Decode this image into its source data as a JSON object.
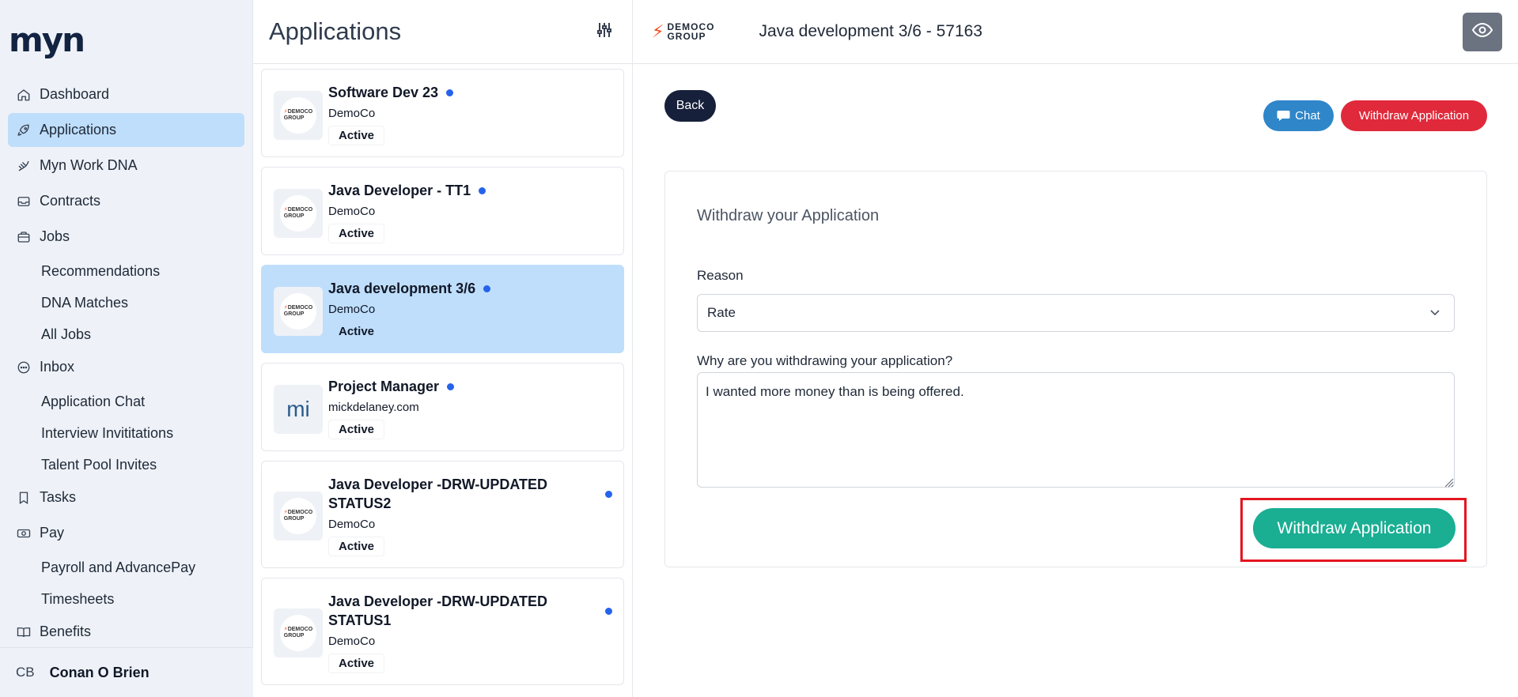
{
  "sidebar": {
    "logo": "myn",
    "items": [
      {
        "label": "Dashboard",
        "icon": "home-icon"
      },
      {
        "label": "Applications",
        "icon": "rocket-icon",
        "active": true
      },
      {
        "label": "Myn Work DNA",
        "icon": "dna-icon"
      },
      {
        "label": "Contracts",
        "icon": "inbox-tray-icon"
      },
      {
        "label": "Jobs",
        "icon": "briefcase-icon",
        "children": [
          "Recommendations",
          "DNA Matches",
          "All Jobs"
        ]
      },
      {
        "label": "Inbox",
        "icon": "chat-bubble-icon",
        "children": [
          "Application Chat",
          "Interview Invititations",
          "Talent Pool Invites"
        ]
      },
      {
        "label": "Tasks",
        "icon": "bookmark-icon"
      },
      {
        "label": "Pay",
        "icon": "money-icon",
        "children": [
          "Payroll and AdvancePay",
          "Timesheets"
        ]
      },
      {
        "label": "Benefits",
        "icon": "book-icon"
      }
    ],
    "user": {
      "initials": "CB",
      "name": "Conan O Brien"
    }
  },
  "list": {
    "title": "Applications",
    "cards": [
      {
        "title": "Software Dev 23",
        "company": "DemoCo",
        "status": "Active",
        "logo": "democo"
      },
      {
        "title": "Java Developer - TT1",
        "company": "DemoCo",
        "status": "Active",
        "logo": "democo"
      },
      {
        "title": "Java development 3/6",
        "company": "DemoCo",
        "status": "Active",
        "logo": "democo",
        "selected": true
      },
      {
        "title": "Project Manager",
        "company": "mickdelaney.com",
        "status": "Active",
        "logo": "mi"
      },
      {
        "title": "Java Developer -DRW-UPDATED STATUS2",
        "company": "DemoCo",
        "status": "Active",
        "logo": "democo"
      },
      {
        "title": "Java Developer -DRW-UPDATED STATUS1",
        "company": "DemoCo",
        "status": "Active",
        "logo": "democo"
      }
    ],
    "mini_logo": {
      "line1": "DEMOCO",
      "line2": "GROUP"
    },
    "mi_text": "mi"
  },
  "main": {
    "brand": {
      "line1": "DEMOCO",
      "line2": "GROUP"
    },
    "job_title": "Java development 3/6 - 57163",
    "back_label": "Back",
    "chat_label": "Chat",
    "withdraw_top_label": "Withdraw Application",
    "panel": {
      "title": "Withdraw your Application",
      "reason_label": "Reason",
      "reason_value": "Rate",
      "why_label": "Why are you withdrawing your application?",
      "why_value": "I wanted more money than is being offered.",
      "submit_label": "Withdraw Application"
    }
  },
  "colors": {
    "accent_blue": "#bfdefb",
    "withdraw_red": "#e0293a",
    "withdraw_green": "#1aae93",
    "chat_blue": "#2f86c9",
    "status_dot": "#2563eb"
  }
}
